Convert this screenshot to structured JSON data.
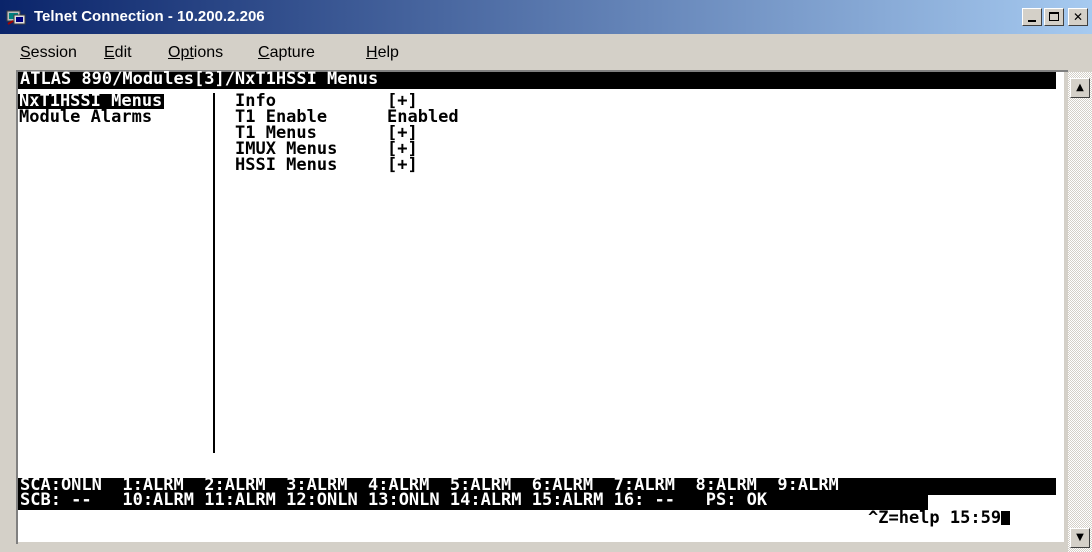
{
  "window": {
    "title": "Telnet Connection - 10.200.2.206",
    "buttons": {
      "minimize": "_",
      "maximize": "□",
      "close": "✕"
    }
  },
  "menubar": [
    {
      "label": "Session",
      "accel": "S",
      "rest": "ession"
    },
    {
      "label": "Edit",
      "accel": "E",
      "rest": "dit"
    },
    {
      "label": "Options",
      "accel": "Opt",
      "rest": "ions"
    },
    {
      "label": "Capture",
      "accel": "C",
      "rest": "apture"
    },
    {
      "label": "Help",
      "accel": "H",
      "rest": "elp"
    }
  ],
  "terminal": {
    "path": "ATLAS 890/Modules[3]/NxT1HSSI Menus",
    "left_menu": [
      "NxT1HSSI Menus",
      "Module Alarms"
    ],
    "right_menu": [
      {
        "label": "Info",
        "value": "[+]"
      },
      {
        "label": "T1 Enable",
        "value": "Enabled"
      },
      {
        "label": "T1 Menus",
        "value": "[+]"
      },
      {
        "label": "IMUX Menus",
        "value": "[+]"
      },
      {
        "label": "HSSI Menus",
        "value": "[+]"
      }
    ],
    "status_line_1": "SCA:ONLN  1:ALRM  2:ALRM  3:ALRM  4:ALRM  5:ALRM  6:ALRM  7:ALRM  8:ALRM  9:ALRM",
    "status_line_2": "SCB: --   10:ALRM 11:ALRM 12:ONLN 13:ONLN 14:ALRM 15:ALRM 16: --   PS: OK",
    "help_line": "^Z=help 15:59"
  },
  "scrollbar": {
    "up": "▲",
    "down": "▼"
  }
}
